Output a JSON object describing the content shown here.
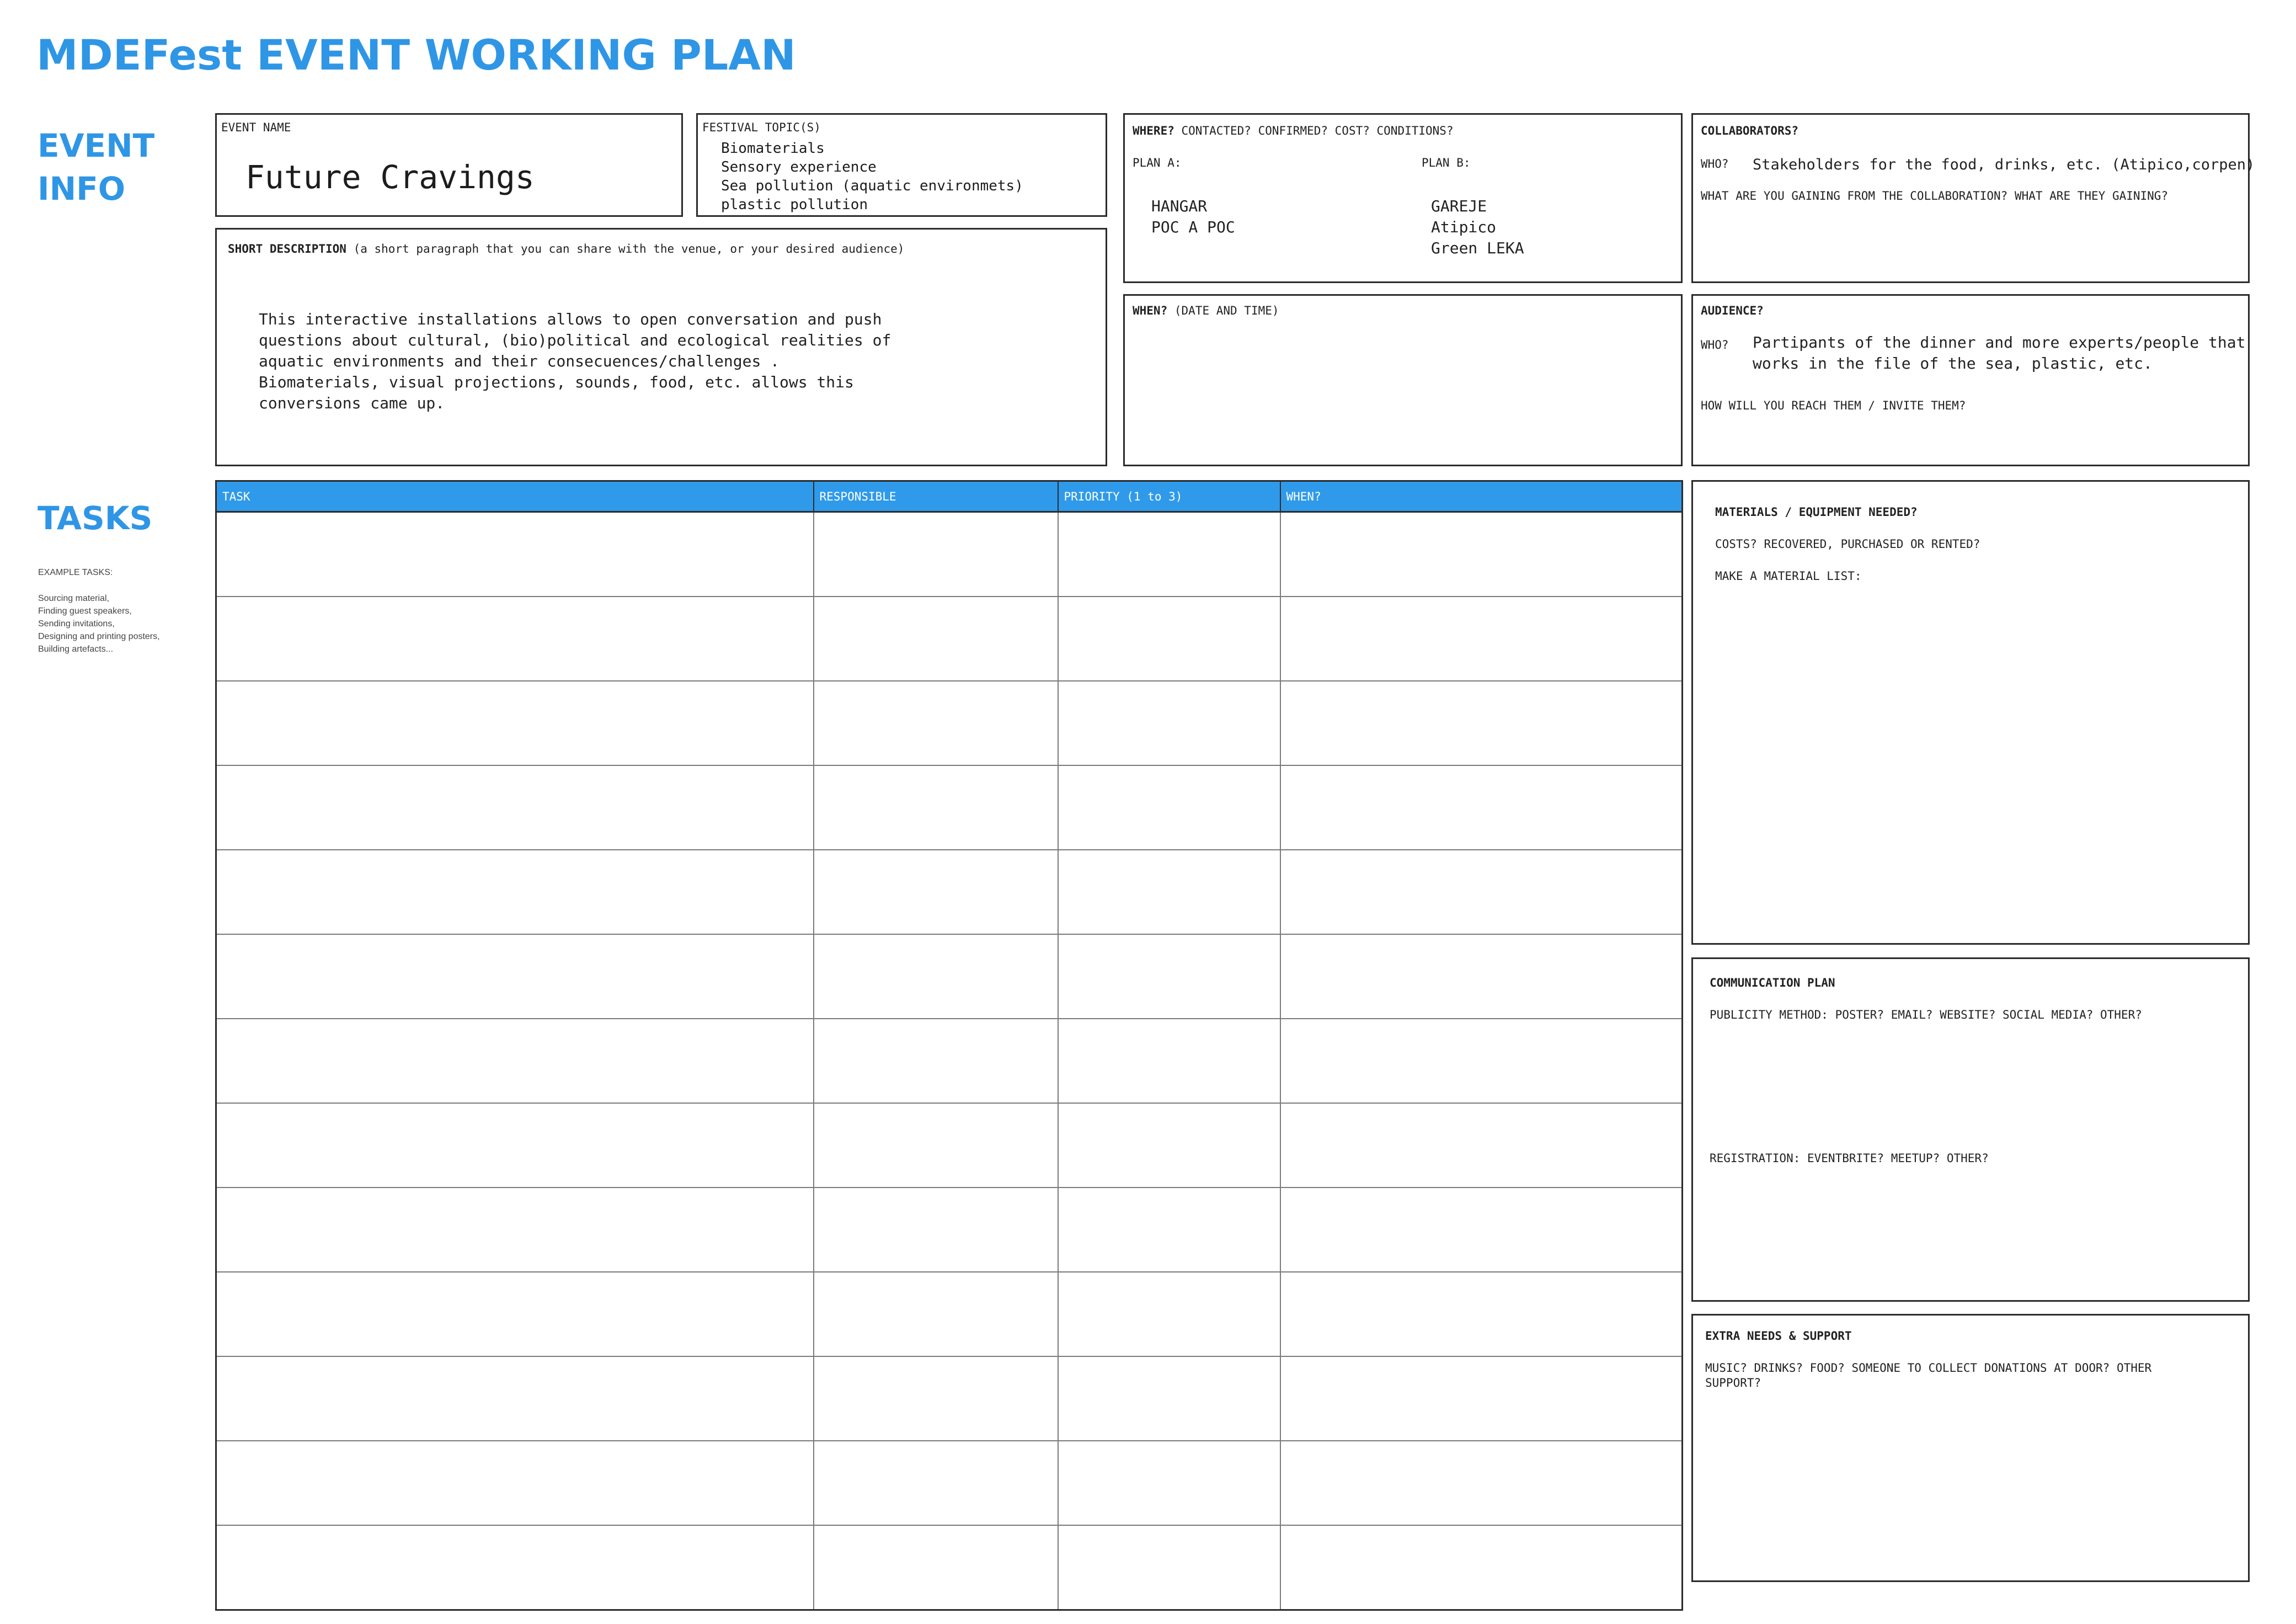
{
  "page_title": "MDEFest EVENT WORKING PLAN",
  "sections": {
    "event_info_line1": "EVENT",
    "event_info_line2": "INFO",
    "tasks": "TASKS"
  },
  "example_tasks": {
    "heading": "EXAMPLE TASKS:",
    "items": [
      "Sourcing material,",
      "Finding guest speakers,",
      "Sending invitations,",
      "Designing and printing posters,",
      "Building artefacts..."
    ]
  },
  "event_name": {
    "label": "EVENT NAME",
    "value": "Future Cravings"
  },
  "festival_topics": {
    "label": "FESTIVAL TOPIC(S)",
    "items": [
      "Biomaterials",
      "Sensory experience",
      "Sea pollution (aquatic environmets)",
      "plastic pollution"
    ]
  },
  "short_description": {
    "label": "SHORT DESCRIPTION",
    "hint": "(a short paragraph that you can share with the venue, or your desired audience)",
    "lines": [
      "This interactive installations allows to open conversation and push",
      "questions about cultural, (bio)political and ecological realities of",
      "aquatic environments and their consecuences/challenges .",
      "Biomaterials, visual projections, sounds, food, etc. allows this",
      "conversions came up."
    ]
  },
  "where": {
    "label": "WHERE?",
    "hint": "CONTACTED?  CONFIRMED? COST? CONDITIONS?",
    "plan_a_label": "PLAN A:",
    "plan_b_label": "PLAN B:",
    "plan_a": [
      "HANGAR",
      "POC A POC"
    ],
    "plan_b": [
      "GAREJE",
      "Atipico",
      "Green LEKA"
    ]
  },
  "when": {
    "label": "WHEN?",
    "hint": "(DATE AND TIME)"
  },
  "collaborators": {
    "label": "COLLABORATORS?",
    "who_label": "WHO?",
    "who_value": "Stakeholders for the food, drinks, etc. (Atipico,corpen)",
    "question": "WHAT ARE YOU GAINING FROM THE COLLABORATION? WHAT ARE THEY GAINING?"
  },
  "audience": {
    "label": "AUDIENCE?",
    "who_label": "WHO?",
    "who_lines": [
      "Partipants of the dinner and more experts/people that",
      "works in the file of the sea, plastic, etc."
    ],
    "question": "HOW WILL YOU REACH THEM / INVITE THEM?"
  },
  "tasks_table": {
    "headers": [
      "TASK",
      "RESPONSIBLE",
      "PRIORITY (1 to 3)",
      "WHEN?"
    ],
    "rows": [
      [
        "",
        "",
        "",
        ""
      ],
      [
        "",
        "",
        "",
        ""
      ],
      [
        "",
        "",
        "",
        ""
      ],
      [
        "",
        "",
        "",
        ""
      ],
      [
        "",
        "",
        "",
        ""
      ],
      [
        "",
        "",
        "",
        ""
      ],
      [
        "",
        "",
        "",
        ""
      ],
      [
        "",
        "",
        "",
        ""
      ],
      [
        "",
        "",
        "",
        ""
      ],
      [
        "",
        "",
        "",
        ""
      ],
      [
        "",
        "",
        "",
        ""
      ],
      [
        "",
        "",
        "",
        ""
      ],
      [
        "",
        "",
        "",
        ""
      ]
    ]
  },
  "materials": {
    "label": "MATERIALS / EQUIPMENT NEEDED?",
    "line1": "COSTS? RECOVERED, PURCHASED OR RENTED?",
    "line2": "MAKE A MATERIAL LIST:"
  },
  "communication": {
    "label": "COMMUNICATION PLAN",
    "line1": "PUBLICITY METHOD: POSTER? EMAIL? WEBSITE? SOCIAL MEDIA? OTHER?",
    "line2": "REGISTRATION: EVENTBRITE? MEETUP? OTHER?"
  },
  "extra_needs": {
    "label": "EXTRA NEEDS & SUPPORT",
    "line1": "MUSIC? DRINKS? FOOD? SOMEONE TO COLLECT DONATIONS AT DOOR? OTHER",
    "line2": "SUPPORT?"
  },
  "colors": {
    "accent": "#2f96e6",
    "header_fill": "#2f9aea",
    "border": "#2b2b2b"
  }
}
